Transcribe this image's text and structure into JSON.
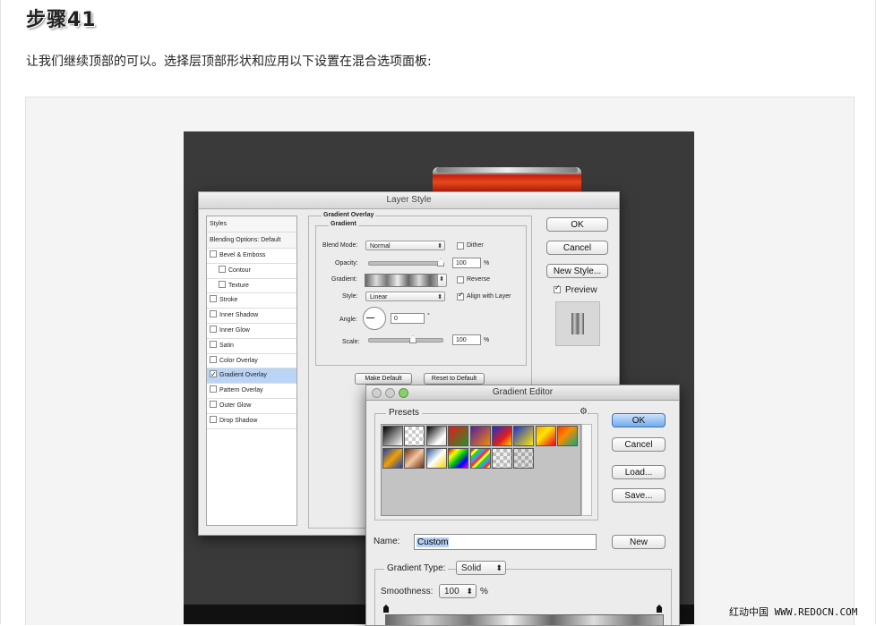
{
  "article": {
    "step_title": "步骤41",
    "intro_text": "让我们继续顶部的可以。选择层顶部形状和应用以下设置在混合选项面板:"
  },
  "layer_style": {
    "title": "Layer Style",
    "styles_header": "Styles",
    "blending_options": "Blending Options: Default",
    "style_items": [
      {
        "label": "Bevel & Emboss",
        "checked": false,
        "selected": false,
        "sub": false
      },
      {
        "label": "Contour",
        "checked": false,
        "selected": false,
        "sub": true
      },
      {
        "label": "Texture",
        "checked": false,
        "selected": false,
        "sub": true
      },
      {
        "label": "Stroke",
        "checked": false,
        "selected": false,
        "sub": false
      },
      {
        "label": "Inner Shadow",
        "checked": false,
        "selected": false,
        "sub": false
      },
      {
        "label": "Inner Glow",
        "checked": false,
        "selected": false,
        "sub": false
      },
      {
        "label": "Satin",
        "checked": false,
        "selected": false,
        "sub": false
      },
      {
        "label": "Color Overlay",
        "checked": false,
        "selected": false,
        "sub": false
      },
      {
        "label": "Gradient Overlay",
        "checked": true,
        "selected": true,
        "sub": false
      },
      {
        "label": "Pattern Overlay",
        "checked": false,
        "selected": false,
        "sub": false
      },
      {
        "label": "Outer Glow",
        "checked": false,
        "selected": false,
        "sub": false
      },
      {
        "label": "Drop Shadow",
        "checked": false,
        "selected": false,
        "sub": false
      }
    ],
    "section_title": "Gradient Overlay",
    "group_title": "Gradient",
    "blend_mode_label": "Blend Mode:",
    "blend_mode_value": "Normal",
    "dither_label": "Dither",
    "opacity_label": "Opacity:",
    "opacity_value": "100",
    "percent": "%",
    "gradient_label": "Gradient:",
    "reverse_label": "Reverse",
    "style_label": "Style:",
    "style_value": "Linear",
    "align_label": "Align with Layer",
    "angle_label": "Angle:",
    "angle_value": "0",
    "degree": "°",
    "scale_label": "Scale:",
    "scale_value": "100",
    "make_default": "Make Default",
    "reset_default": "Reset to Default",
    "ok": "OK",
    "cancel": "Cancel",
    "new_style": "New Style...",
    "preview_label": "Preview"
  },
  "gradient_editor": {
    "title": "Gradient Editor",
    "presets_label": "Presets",
    "gear_icon": "⚙.",
    "ok": "OK",
    "cancel": "Cancel",
    "load": "Load...",
    "save": "Save...",
    "name_label": "Name:",
    "name_value": "Custom",
    "new_button": "New",
    "gradient_type_label": "Gradient Type:",
    "gradient_type_value": "Solid",
    "smoothness_label": "Smoothness:",
    "smoothness_value": "100",
    "percent": "%",
    "preset_swatches": [
      "linear-gradient(135deg,#000 0%,#fff 100%)",
      "repeating-conic-gradient(#ccc 0 25%,#fff 0 50%) 0 0/8px 8px",
      "linear-gradient(135deg,#000 0%,#fff 70%,#ddd 100%)",
      "linear-gradient(135deg,#e41b1b 0%,#2a8f2a 100%)",
      "linear-gradient(135deg,#5a1ba8 0%,#f08a00 100%)",
      "linear-gradient(135deg,#1c2fd1 0%,#e21c1c 60%,#ffd400 100%)",
      "linear-gradient(135deg,#1b2fd6 0%,#ffea00 100%)",
      "linear-gradient(135deg,#f4a300 0%,#ffe600 40%,#e8002b 100%)",
      "linear-gradient(135deg,#e40 0%,#f80 40%,#1a7 100%)",
      "linear-gradient(135deg,#1b3fb8 0%,#f0a000 50%,#1b3fb8 100%)",
      "linear-gradient(135deg,#6b2f10 0%,#f4c4a0 50%,#6b2f10 100%)",
      "linear-gradient(135deg,#2a5a9a 0%,#fff 50%,#f5d000 100%)",
      "linear-gradient(135deg,#e00 0%,#ff0 25%,#0c0 50%,#00f 75%,#f0f 100%)",
      "repeating-linear-gradient(135deg,#f33 0 3px,#ff3 3px 6px,#3c3 6px 9px,#39f 9px 12px)",
      "repeating-conic-gradient(#bbb 0 25%,#eee 0 50%) 0 0/8px 8px",
      "repeating-conic-gradient(#aaa 0 25%,#ddd 0 50%) 0 0/8px 8px"
    ]
  },
  "watermark": "红动中国 WWW.REDOCN.COM"
}
